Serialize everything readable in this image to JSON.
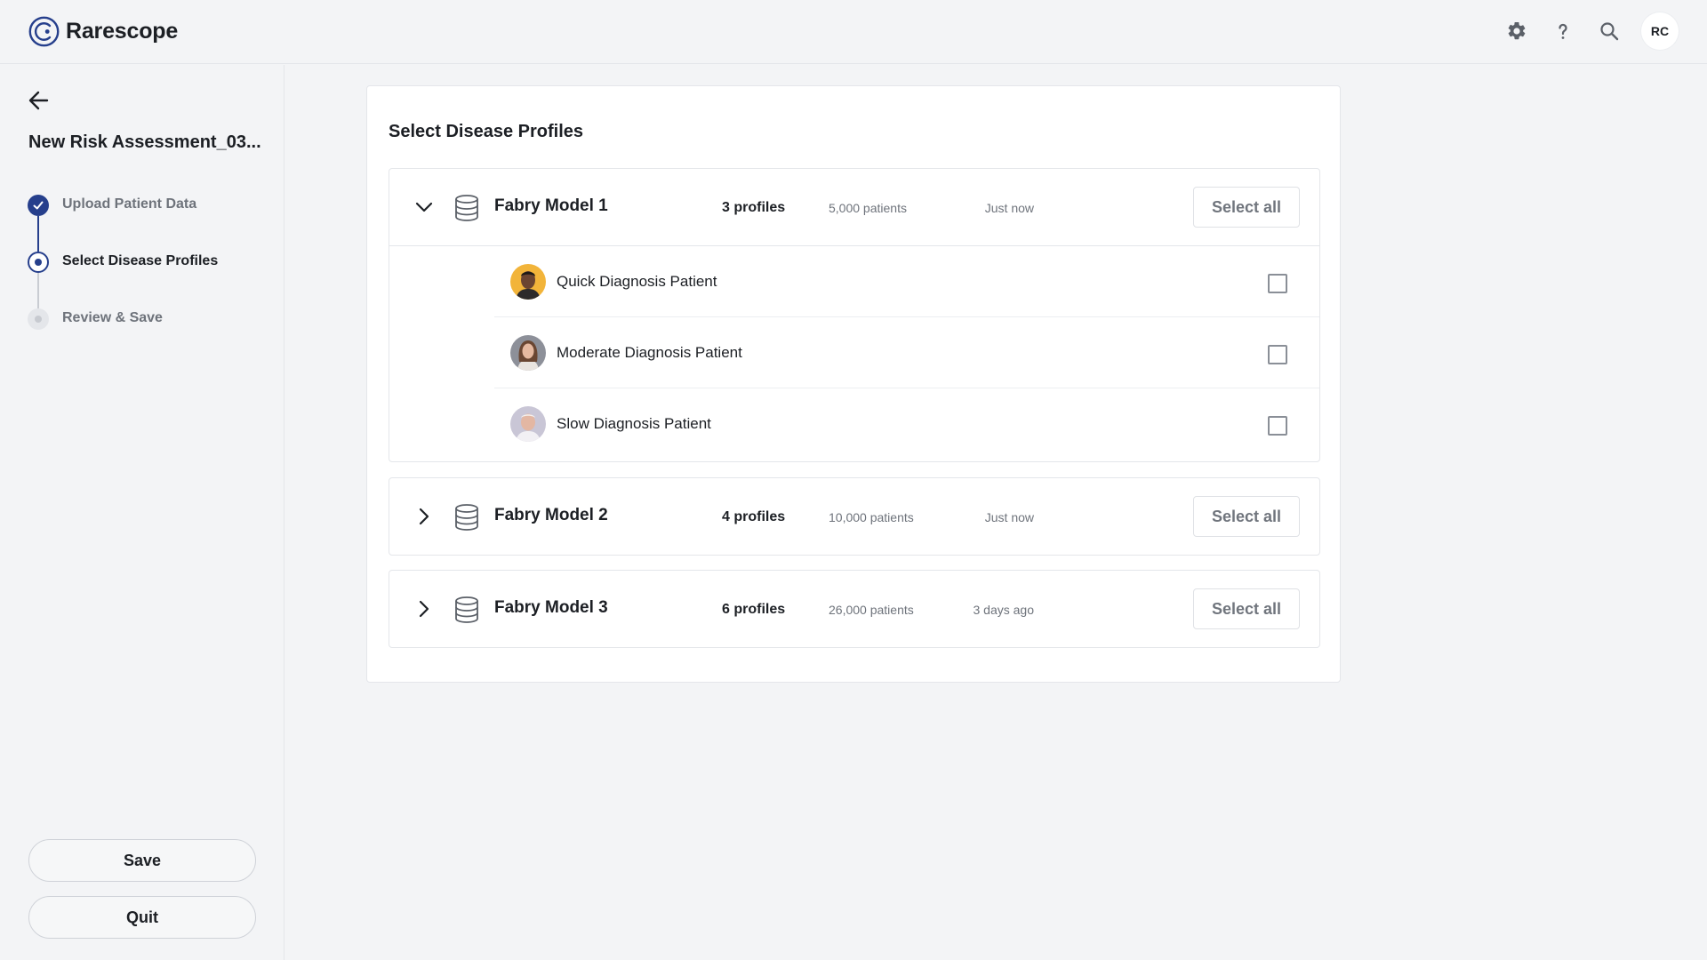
{
  "app": {
    "name": "Rarescope"
  },
  "header": {
    "user_initials": "RC",
    "icons": [
      "gear-icon",
      "help-icon",
      "search-icon"
    ]
  },
  "sidebar": {
    "assessment_title": "New Risk Assessment_03...",
    "steps": [
      {
        "label": "Upload Patient Data",
        "status": "completed"
      },
      {
        "label": "Select Disease Profiles",
        "status": "current"
      },
      {
        "label": "Review & Save",
        "status": "pending"
      }
    ],
    "save_label": "Save",
    "quit_label": "Quit"
  },
  "main": {
    "title": "Select Disease Profiles",
    "models": [
      {
        "name": "Fabry Model 1",
        "profiles": "3 profiles",
        "patients": "5,000 patients",
        "updated": "Just now",
        "select_all_label": "Select all",
        "expanded": true,
        "items": [
          {
            "name": "Quick Diagnosis Patient",
            "checked": false
          },
          {
            "name": "Moderate Diagnosis Patient",
            "checked": false
          },
          {
            "name": "Slow Diagnosis Patient",
            "checked": false
          }
        ]
      },
      {
        "name": "Fabry Model 2",
        "profiles": "4 profiles",
        "patients": "10,000 patients",
        "updated": "Just now",
        "select_all_label": "Select all",
        "expanded": false
      },
      {
        "name": "Fabry Model 3",
        "profiles": "6 profiles",
        "patients": "26,000 patients",
        "updated": "3 days ago",
        "select_all_label": "Select all",
        "expanded": false
      }
    ]
  },
  "colors": {
    "accent": "#263f8c",
    "background": "#f3f4f6",
    "card": "#ffffff",
    "border": "#e4e6ea"
  }
}
